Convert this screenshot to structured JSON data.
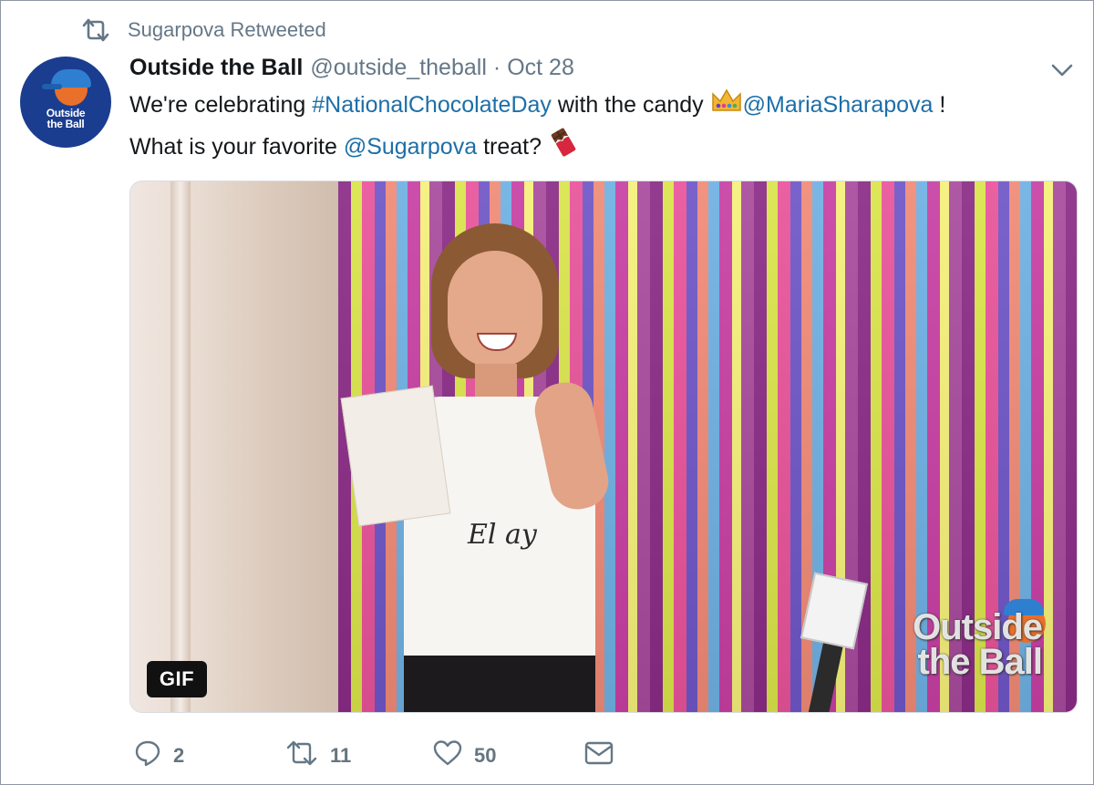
{
  "retweet_context": {
    "icon": "retweet-icon",
    "text": "Sugarpova Retweeted"
  },
  "avatar": {
    "text_line1": "Outside",
    "text_line2": "the Ball"
  },
  "tweet": {
    "author_name": "Outside the Ball",
    "author_handle": "@outside_theball",
    "separator": "·",
    "timestamp": "Oct 28",
    "text_part1": "We're celebrating ",
    "hashtag": "#NationalChocolateDay",
    "text_part2": " with the candy ",
    "mention1": "@MariaSharapova",
    "text_part3": " !",
    "text_part4": "What is your favorite ",
    "mention2": "@Sugarpova",
    "text_part5": " treat? ",
    "emoji1": "crown-emoji",
    "emoji2": "chocolate-bar-emoji"
  },
  "media": {
    "type_badge": "GIF",
    "shirt_text": "El ay",
    "watermark_line1": "Outside",
    "watermark_line2": "the Ball"
  },
  "actions": {
    "reply_count": "2",
    "retweet_count": "11",
    "like_count": "50"
  },
  "colors": {
    "link": "#1c6fa8",
    "muted": "#657786",
    "text": "#14171a"
  }
}
